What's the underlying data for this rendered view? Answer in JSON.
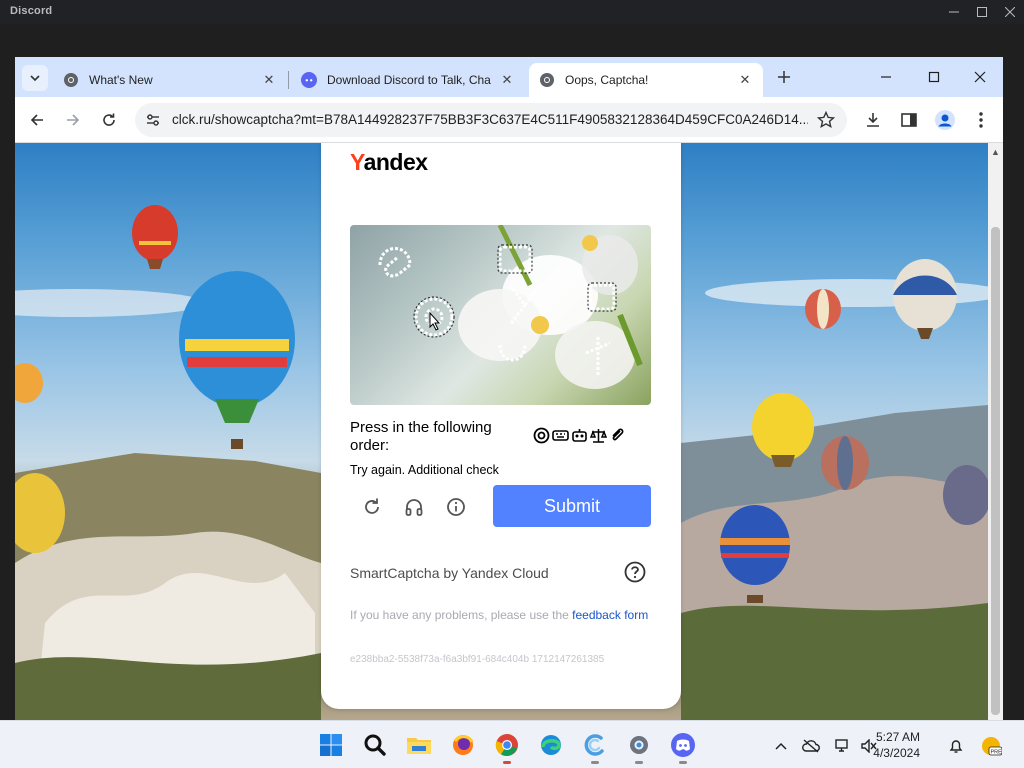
{
  "discord_window": {
    "title": "Discord"
  },
  "browser": {
    "tabs": [
      {
        "title": "What's New",
        "favicon": "chrome-icon"
      },
      {
        "title": "Download Discord to Talk, Cha",
        "favicon": "discord-icon"
      },
      {
        "title": "Oops, Captcha!",
        "favicon": "chrome-icon",
        "active": true
      }
    ],
    "url": "clck.ru/showcaptcha?mt=B78A144928237F75BB3F3C637E4C511F4905832128364D459CFC0A246D14..."
  },
  "captcha": {
    "brand": {
      "first_letter": "Y",
      "rest": "andex"
    },
    "instruction": "Press in the following order:",
    "order_icons": [
      "at-sign-icon",
      "keyboard-icon",
      "robot-icon",
      "scales-icon",
      "paperclip-icon"
    ],
    "hint": "Try again. Additional check",
    "submit_label": "Submit",
    "smartcaptcha_label": "SmartCaptcha by Yandex Cloud",
    "problems_text": "If you have any problems, please use the",
    "feedback_link": "feedback form",
    "hash": "e238bba2-5538f73a-f6a3bf91-684c404b 1712147261385"
  },
  "taskbar": {
    "apps": [
      "windows-start-icon",
      "search-icon",
      "file-explorer-icon",
      "firefox-icon",
      "chrome-icon",
      "edge-icon",
      "ccleaner-icon",
      "settings-icon",
      "discord-icon"
    ],
    "time": "5:27 AM",
    "date": "4/3/2024"
  },
  "colors": {
    "submit": "#5282ff",
    "yandex_red": "#fc3f1d",
    "link": "#1a55c9"
  }
}
